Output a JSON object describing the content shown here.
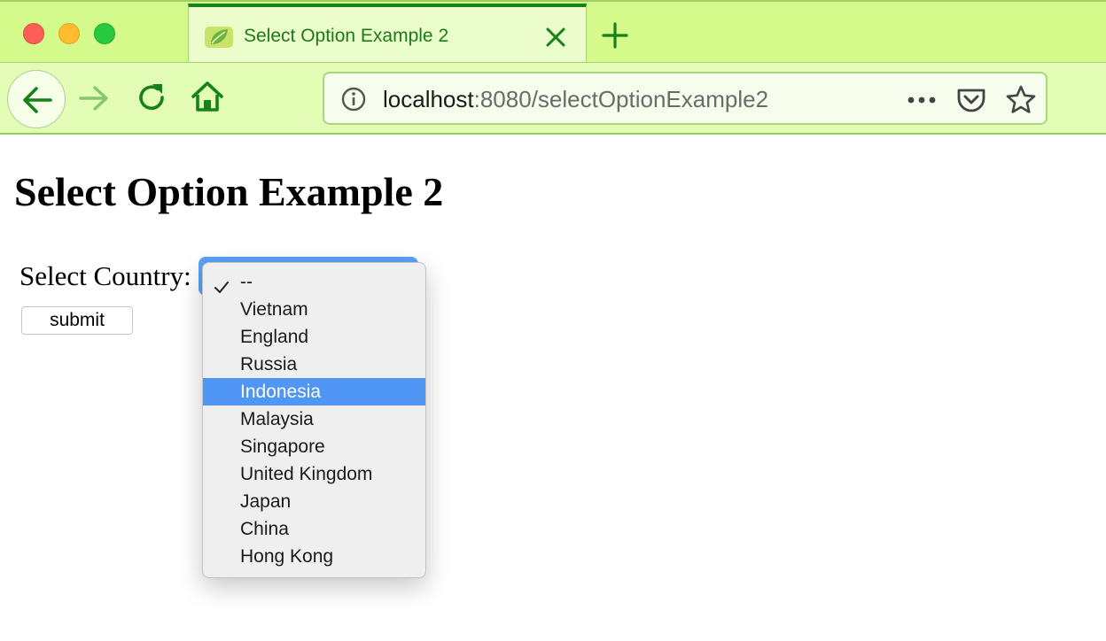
{
  "browser": {
    "tab": {
      "title": "Select Option Example 2",
      "favicon": "spring-leaf-icon",
      "close_icon": "close-icon"
    },
    "new_tab_icon": "plus-icon",
    "nav": {
      "back_icon": "back-arrow-icon",
      "forward_icon": "forward-arrow-icon",
      "reload_icon": "reload-icon",
      "home_icon": "home-icon"
    },
    "url": {
      "host": "localhost",
      "rest": ":8080/selectOptionExample2",
      "info_icon": "info-icon",
      "more_icon": "ellipsis-icon",
      "pocket_icon": "pocket-icon",
      "bookmark_icon": "star-icon"
    },
    "colors": {
      "tabstrip": "#d4fa8c",
      "active_tab": "#ebfdcb",
      "accent": "#17811a",
      "toolbar": "#e3fdb7"
    }
  },
  "page": {
    "heading": "Select Option Example 2",
    "form": {
      "label": "Select Country:",
      "submit_label": "submit"
    }
  },
  "dropdown": {
    "options": [
      {
        "label": "--",
        "checked": true,
        "highlighted": false
      },
      {
        "label": "Vietnam",
        "checked": false,
        "highlighted": false
      },
      {
        "label": "England",
        "checked": false,
        "highlighted": false
      },
      {
        "label": "Russia",
        "checked": false,
        "highlighted": false
      },
      {
        "label": "Indonesia",
        "checked": false,
        "highlighted": true
      },
      {
        "label": "Malaysia",
        "checked": false,
        "highlighted": false
      },
      {
        "label": "Singapore",
        "checked": false,
        "highlighted": false
      },
      {
        "label": "United Kingdom",
        "checked": false,
        "highlighted": false
      },
      {
        "label": "Japan",
        "checked": false,
        "highlighted": false
      },
      {
        "label": "China",
        "checked": false,
        "highlighted": false
      },
      {
        "label": "Hong Kong",
        "checked": false,
        "highlighted": false
      }
    ],
    "highlight_color": "#4f96f5"
  }
}
